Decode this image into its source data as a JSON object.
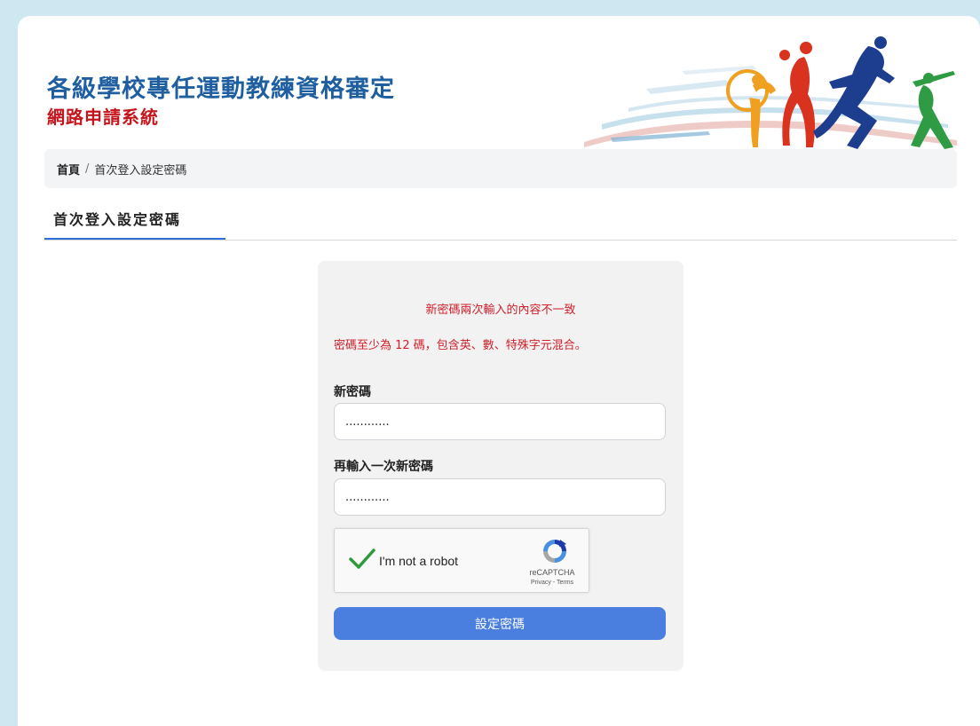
{
  "header": {
    "title": "各級學校專任運動教練資格審定",
    "subtitle": "網路申請系統"
  },
  "breadcrumb": {
    "home": "首頁",
    "separator": "/",
    "current": "首次登入設定密碼"
  },
  "section": {
    "title": "首次登入設定密碼"
  },
  "form": {
    "error_mismatch": "新密碼兩次輸入的內容不一致",
    "password_rule": "密碼至少為 12 碼，包含英、數、特殊字元混合。",
    "new_password_label": "新密碼",
    "new_password_value": "............",
    "confirm_password_label": "再輸入一次新密碼",
    "confirm_password_value": "............",
    "submit_label": "設定密碼"
  },
  "captcha": {
    "label": "I'm not a robot",
    "brand": "reCAPTCHA",
    "links": "Privacy - Terms",
    "checked": true,
    "check_color": "#2e9b3b"
  },
  "colors": {
    "title_blue": "#1f5fa0",
    "subtitle_red": "#c4161c",
    "error_red": "#d0202b",
    "button_blue": "#4a7fe0",
    "tab_underline": "#2f6fd6"
  }
}
